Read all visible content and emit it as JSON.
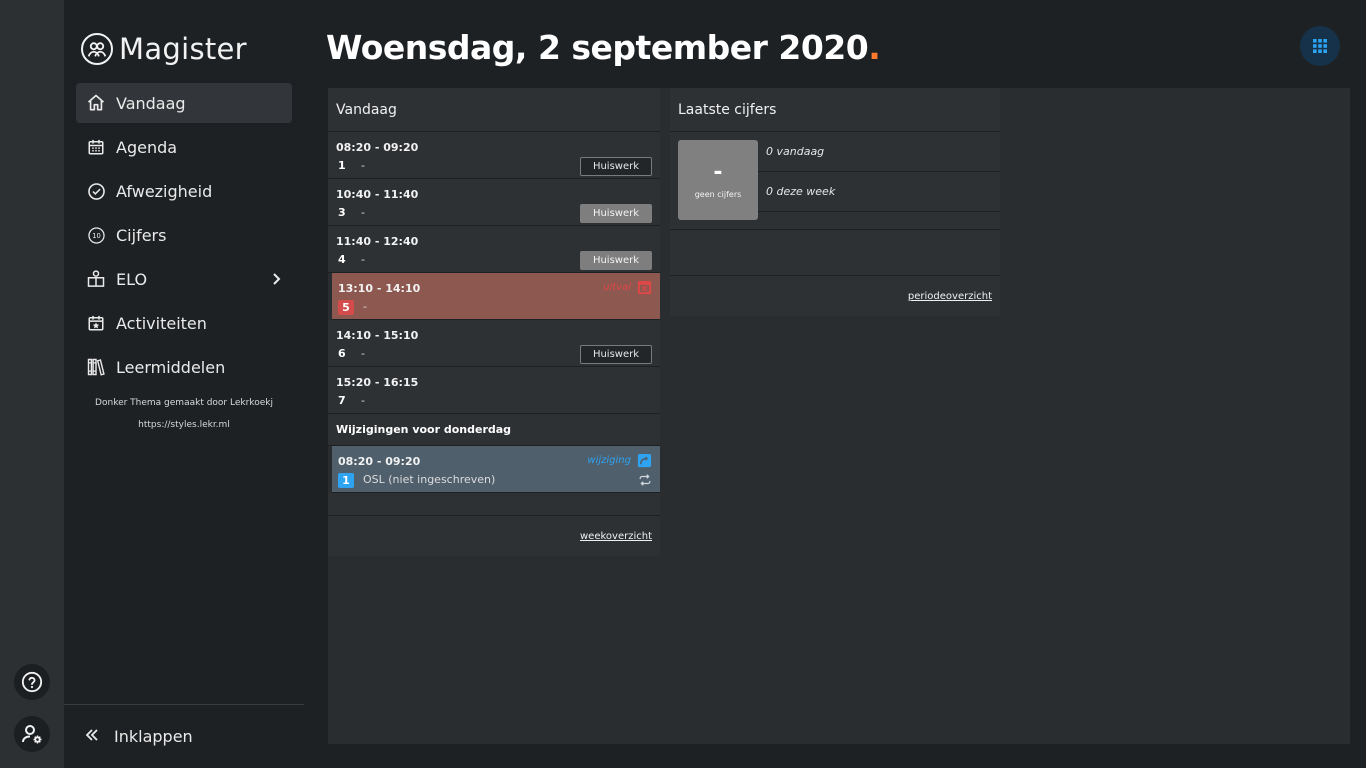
{
  "sidebar": {
    "logo_text": "Magister",
    "items": [
      {
        "label": "Vandaag",
        "icon": "home-icon",
        "active": true
      },
      {
        "label": "Agenda",
        "icon": "calendar-icon"
      },
      {
        "label": "Afwezigheid",
        "icon": "check-circle-icon"
      },
      {
        "label": "Cijfers",
        "icon": "grade-10-icon"
      },
      {
        "label": "ELO",
        "icon": "elo-icon",
        "has_submenu": true
      },
      {
        "label": "Activiteiten",
        "icon": "calendar-star-icon"
      },
      {
        "label": "Leermiddelen",
        "icon": "books-icon"
      }
    ],
    "credit_line1": "Donker Thema gemaakt door Lekrkoekj",
    "credit_line2": "https://styles.lekr.ml",
    "collapse_label": "Inklappen"
  },
  "header": {
    "title": "Woensdag, 2 september 2020",
    "title_dot": "."
  },
  "today": {
    "title": "Vandaag",
    "lessons": [
      {
        "time": "08:20 - 09:20",
        "hour": "1",
        "subject": "-",
        "homework": "Huiswerk",
        "hw_style": "outline"
      },
      {
        "time": "10:40 - 11:40",
        "hour": "3",
        "subject": "-",
        "homework": "Huiswerk",
        "hw_style": "filled"
      },
      {
        "time": "11:40 - 12:40",
        "hour": "4",
        "subject": "-",
        "homework": "Huiswerk",
        "hw_style": "filled"
      },
      {
        "time": "13:10 - 14:10",
        "hour": "5",
        "subject": "-",
        "status": "uitval"
      },
      {
        "time": "14:10 - 15:10",
        "hour": "6",
        "subject": "-",
        "homework": "Huiswerk",
        "hw_style": "outline"
      },
      {
        "time": "15:20 - 16:15",
        "hour": "7",
        "subject": "-"
      }
    ],
    "changes_title": "Wijzigingen voor donderdag",
    "change": {
      "time": "08:20 - 09:20",
      "hour": "1",
      "subject": "OSL (niet ingeschreven)",
      "status": "wijziging"
    },
    "footer_link": "weekoverzicht"
  },
  "grades": {
    "title": "Laatste cijfers",
    "grade_value": "-",
    "grade_caption": "geen cijfers",
    "today_count": "0 vandaag",
    "week_count": "0 deze week",
    "footer_link": "periodeoverzicht"
  },
  "colors": {
    "accent_dot": "#ff7a2f",
    "cancel": "#d44b4b",
    "change": "#2ea3f2"
  }
}
